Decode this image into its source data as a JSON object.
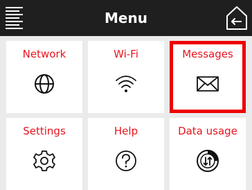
{
  "header": {
    "title": "Menu",
    "menu_icon": "hamburger-icon",
    "back_icon": "home-back-icon"
  },
  "tiles": [
    {
      "label": "Network",
      "icon": "globe-icon"
    },
    {
      "label": "Wi-Fi",
      "icon": "wifi-icon"
    },
    {
      "label": "Messages",
      "icon": "envelope-icon",
      "selected": true
    },
    {
      "label": "Settings",
      "icon": "gear-icon"
    },
    {
      "label": "Help",
      "icon": "question-icon"
    },
    {
      "label": "Data usage",
      "icon": "data-usage-icon"
    }
  ],
  "colors": {
    "header_bg": "#1f1f1f",
    "label": "#e8141e",
    "selection_border": "#ee0000",
    "background": "#ebebeb"
  }
}
